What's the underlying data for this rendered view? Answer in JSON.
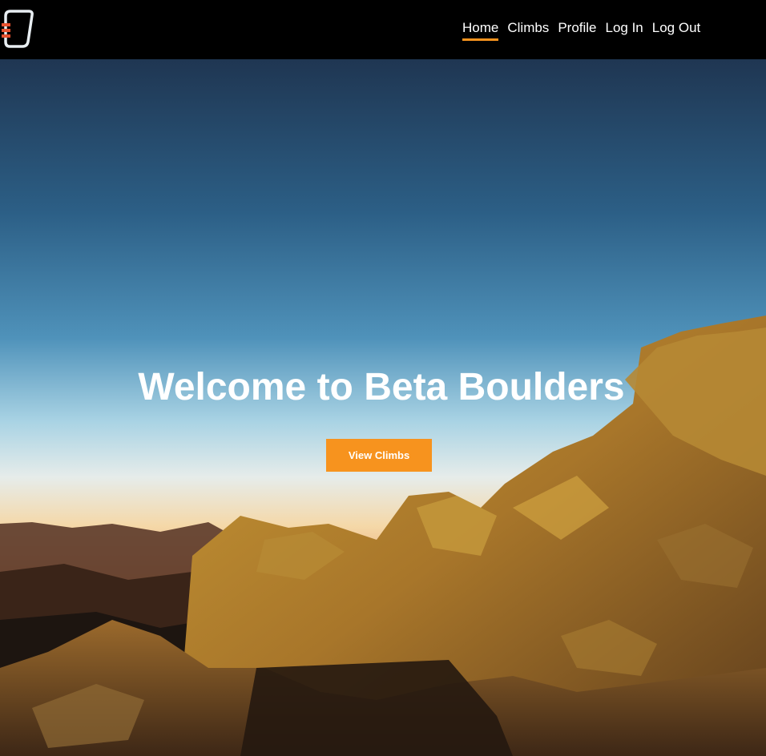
{
  "nav": {
    "logo_icon": "carabiner-icon",
    "links": [
      {
        "label": "Home",
        "active": true
      },
      {
        "label": "Climbs",
        "active": false
      },
      {
        "label": "Profile",
        "active": false
      },
      {
        "label": "Log In",
        "active": false
      },
      {
        "label": "Log Out",
        "active": false
      }
    ]
  },
  "hero": {
    "title": "Welcome to Beta Boulders",
    "button_label": "View Climbs",
    "background": "mountain-rock-sunset-photo"
  },
  "colors": {
    "nav_bg": "#000000",
    "accent": "#f7931e",
    "text": "#ffffff",
    "sky_top": "#1f3652",
    "sky_horizon": "#f4c98e",
    "rock": "#b98a2a"
  }
}
